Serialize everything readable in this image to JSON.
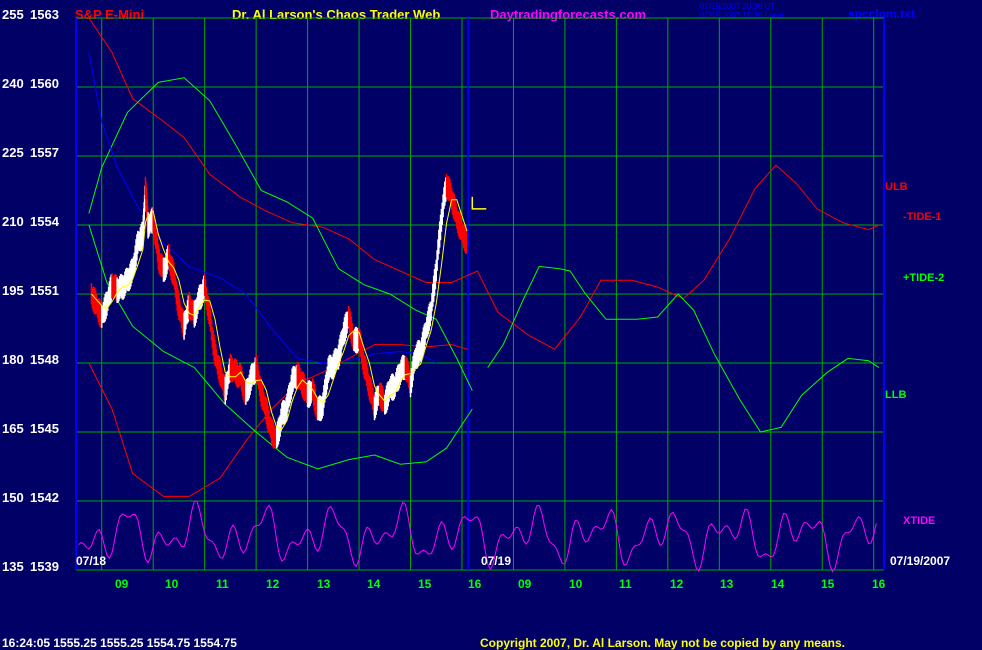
{
  "header": {
    "instrument": "S&P E-Mini",
    "title": "Dr. Al Larson's Chaos Trader Web",
    "site": "Daytradingforecasts.com",
    "timestamp1": "07/19/2007 20:30 UT",
    "timestamp2": "07/19/2007 15:30 Local",
    "file": "spcclom.txt"
  },
  "footer": {
    "quote": "16:24:05  1555.25  1555.25  1554.75  1554.75",
    "copyright": "Copyright 2007, Dr. Al Larson. May not be copied by any means."
  },
  "colors": {
    "background": "#000066",
    "grid": "#00aa00",
    "price_up": "#ffffff",
    "price_down": "#ff0000",
    "ma": "#ffff00",
    "ulb": "#ff0000",
    "tide1": "#ff0000",
    "tide2": "#00ff00",
    "llb": "#00ff00",
    "blue_avg": "#0000ff",
    "xtide": "#ff00ff",
    "instrument_label": "#ff0000",
    "title": "#ffff00",
    "site": "#ff00ff",
    "file": "#0000ff"
  },
  "chart_data": {
    "type": "line",
    "ylabels": [
      {
        "left": "255",
        "right": "1563"
      },
      {
        "left": "240",
        "right": "1560"
      },
      {
        "left": "225",
        "right": "1557"
      },
      {
        "left": "210",
        "right": "1554"
      },
      {
        "left": "195",
        "right": "1551"
      },
      {
        "left": "180",
        "right": "1548"
      },
      {
        "left": "165",
        "right": "1545"
      },
      {
        "left": "150",
        "right": "1542"
      },
      {
        "left": "135",
        "right": "1539"
      }
    ],
    "ylim": [
      1539,
      1563
    ],
    "xlim": [
      8.5,
      24.2
    ],
    "date_left": "07/18",
    "date_mid": "07/19",
    "date_right": "07/19/2007",
    "xticks": [
      {
        "label": "09",
        "x": 9
      },
      {
        "label": "10",
        "x": 10
      },
      {
        "label": "11",
        "x": 11
      },
      {
        "label": "12",
        "x": 12
      },
      {
        "label": "13",
        "x": 13
      },
      {
        "label": "14",
        "x": 14
      },
      {
        "label": "15",
        "x": 15
      },
      {
        "label": "16",
        "x": 16
      },
      {
        "label": "09",
        "x": 17
      },
      {
        "label": "10",
        "x": 18
      },
      {
        "label": "11",
        "x": 19
      },
      {
        "label": "12",
        "x": 20
      },
      {
        "label": "13",
        "x": 21
      },
      {
        "label": "14",
        "x": 22
      },
      {
        "label": "15",
        "x": 23
      },
      {
        "label": "16",
        "x": 24
      }
    ],
    "day_divider_x": 16.12,
    "series": [
      {
        "name": "ULB",
        "key": "ulb",
        "points": [
          [
            8.75,
            1563
          ],
          [
            9.2,
            1561.5
          ],
          [
            9.6,
            1559.5
          ],
          [
            10.2,
            1558.5
          ],
          [
            10.6,
            1557.8
          ],
          [
            11.1,
            1556.2
          ],
          [
            11.7,
            1555.2
          ],
          [
            12.2,
            1554.6
          ],
          [
            12.7,
            1554.1
          ],
          [
            13.3,
            1553.9
          ],
          [
            13.8,
            1553.4
          ],
          [
            14.3,
            1552.5
          ],
          [
            14.8,
            1552.0
          ],
          [
            15.3,
            1551.5
          ],
          [
            15.8,
            1551.5
          ],
          [
            16.3,
            1552.0
          ],
          [
            16.7,
            1550.2
          ],
          [
            17.3,
            1549.2
          ],
          [
            17.8,
            1548.6
          ],
          [
            18.3,
            1550.0
          ],
          [
            18.7,
            1551.6
          ],
          [
            19.3,
            1551.6
          ],
          [
            19.8,
            1551.3
          ],
          [
            20.3,
            1550.8
          ],
          [
            20.7,
            1551.6
          ],
          [
            21.2,
            1553.4
          ],
          [
            21.7,
            1555.6
          ],
          [
            22.1,
            1556.6
          ],
          [
            22.5,
            1555.8
          ],
          [
            22.9,
            1554.7
          ],
          [
            23.4,
            1554.1
          ],
          [
            23.9,
            1553.8
          ],
          [
            24.1,
            1554.0
          ]
        ]
      },
      {
        "name": "-TIDE-1",
        "key": "tide1",
        "points": [
          [
            8.75,
            1548
          ],
          [
            9.2,
            1546.0
          ],
          [
            9.6,
            1543.2
          ],
          [
            10.2,
            1542.2
          ],
          [
            10.7,
            1542.2
          ],
          [
            11.3,
            1543.0
          ],
          [
            11.8,
            1544.6
          ],
          [
            12.3,
            1546.0
          ],
          [
            12.8,
            1547.1
          ],
          [
            13.3,
            1547.6
          ],
          [
            13.8,
            1548.2
          ],
          [
            14.3,
            1548.8
          ],
          [
            14.8,
            1548.8
          ],
          [
            15.3,
            1548.7
          ],
          [
            15.8,
            1548.8
          ],
          [
            16.1,
            1548.6
          ]
        ]
      },
      {
        "name": "+TIDE-2",
        "key": "tide2",
        "points": [
          [
            16.5,
            1547.8
          ],
          [
            16.8,
            1548.8
          ],
          [
            17.2,
            1550.8
          ],
          [
            17.5,
            1552.2
          ],
          [
            17.9,
            1552.1
          ],
          [
            18.1,
            1552.0
          ],
          [
            18.4,
            1551.0
          ],
          [
            18.8,
            1549.9
          ],
          [
            19.4,
            1549.9
          ],
          [
            19.8,
            1550.0
          ],
          [
            20.2,
            1551.0
          ],
          [
            20.5,
            1550.3
          ],
          [
            20.9,
            1548.4
          ],
          [
            21.4,
            1546.4
          ],
          [
            21.8,
            1545.0
          ],
          [
            22.2,
            1545.2
          ],
          [
            22.6,
            1546.6
          ],
          [
            23.1,
            1547.6
          ],
          [
            23.5,
            1548.2
          ],
          [
            23.9,
            1548.1
          ],
          [
            24.1,
            1547.8
          ]
        ]
      },
      {
        "name": "LLB",
        "key": "llb",
        "points": [
          [
            8.75,
            1554.5
          ],
          [
            9.0,
            1556.5
          ],
          [
            9.5,
            1558.9
          ],
          [
            10.1,
            1560.2
          ],
          [
            10.6,
            1560.4
          ],
          [
            11.1,
            1559.4
          ],
          [
            11.6,
            1557.5
          ],
          [
            12.1,
            1555.5
          ],
          [
            12.6,
            1555.0
          ],
          [
            13.1,
            1554.3
          ],
          [
            13.6,
            1552.1
          ],
          [
            14.1,
            1551.4
          ],
          [
            14.6,
            1551.0
          ],
          [
            15.1,
            1550.3
          ],
          [
            15.5,
            1549.9
          ],
          [
            15.9,
            1548.2
          ],
          [
            16.2,
            1546.8
          ]
        ]
      },
      {
        "name": "",
        "key": "blue_avg",
        "points": [
          [
            8.75,
            1561.5
          ],
          [
            9.0,
            1558.5
          ],
          [
            9.3,
            1556.5
          ],
          [
            9.7,
            1554.8
          ],
          [
            10.2,
            1553.2
          ],
          [
            10.7,
            1552.2
          ],
          [
            11.3,
            1551.7
          ],
          [
            11.8,
            1551.0
          ],
          [
            12.3,
            1549.5
          ],
          [
            12.8,
            1548.2
          ],
          [
            13.3,
            1548.0
          ],
          [
            13.8,
            1548.1
          ],
          [
            14.3,
            1548.4
          ],
          [
            14.8,
            1548.5
          ],
          [
            15.2,
            1548.4
          ],
          [
            15.5,
            1548.0
          ]
        ]
      },
      {
        "name": "",
        "key": "llb_lower",
        "points": [
          [
            8.75,
            1554.0
          ],
          [
            9.1,
            1551.5
          ],
          [
            9.6,
            1549.6
          ],
          [
            10.2,
            1548.5
          ],
          [
            10.8,
            1547.8
          ],
          [
            11.4,
            1546.2
          ],
          [
            12.0,
            1545.0
          ],
          [
            12.6,
            1543.9
          ],
          [
            13.2,
            1543.4
          ],
          [
            13.8,
            1543.8
          ],
          [
            14.3,
            1544.0
          ],
          [
            14.8,
            1543.6
          ],
          [
            15.3,
            1543.7
          ],
          [
            15.7,
            1544.3
          ],
          [
            16.2,
            1546.0
          ]
        ]
      }
    ],
    "xtide": {
      "name": "XTIDE",
      "baseline": 1540.5,
      "amp": 1.2
    },
    "price": [
      [
        8.8,
        1551.0
      ],
      [
        8.9,
        1550.5
      ],
      [
        9.0,
        1550.0
      ],
      [
        9.1,
        1550.6
      ],
      [
        9.2,
        1551.4
      ],
      [
        9.3,
        1551.2
      ],
      [
        9.4,
        1551.3
      ],
      [
        9.5,
        1551.6
      ],
      [
        9.6,
        1552.0
      ],
      [
        9.7,
        1553.2
      ],
      [
        9.8,
        1553.6
      ],
      [
        9.85,
        1555.6
      ],
      [
        9.9,
        1554.0
      ],
      [
        10.0,
        1554.2
      ],
      [
        10.1,
        1552.6
      ],
      [
        10.2,
        1552.0
      ],
      [
        10.3,
        1552.6
      ],
      [
        10.4,
        1551.8
      ],
      [
        10.5,
        1550.4
      ],
      [
        10.6,
        1549.6
      ],
      [
        10.7,
        1550.5
      ],
      [
        10.8,
        1550.1
      ],
      [
        10.9,
        1550.8
      ],
      [
        11.0,
        1551.3
      ],
      [
        11.1,
        1550.0
      ],
      [
        11.2,
        1548.4
      ],
      [
        11.3,
        1547.6
      ],
      [
        11.4,
        1546.8
      ],
      [
        11.5,
        1547.8
      ],
      [
        11.6,
        1547.6
      ],
      [
        11.7,
        1547.4
      ],
      [
        11.8,
        1546.6
      ],
      [
        11.9,
        1547.3
      ],
      [
        12.0,
        1547.8
      ],
      [
        12.1,
        1546.7
      ],
      [
        12.2,
        1545.9
      ],
      [
        12.3,
        1545.0
      ],
      [
        12.4,
        1544.7
      ],
      [
        12.5,
        1545.7
      ],
      [
        12.6,
        1546.1
      ],
      [
        12.7,
        1547.2
      ],
      [
        12.8,
        1547.5
      ],
      [
        12.9,
        1547.1
      ],
      [
        13.0,
        1546.6
      ],
      [
        13.1,
        1546.8
      ],
      [
        13.2,
        1545.9
      ],
      [
        13.3,
        1546.2
      ],
      [
        13.4,
        1547.7
      ],
      [
        13.5,
        1547.9
      ],
      [
        13.6,
        1548.3
      ],
      [
        13.7,
        1549.3
      ],
      [
        13.8,
        1550.0
      ],
      [
        13.9,
        1548.9
      ],
      [
        14.0,
        1549.1
      ],
      [
        14.1,
        1547.9
      ],
      [
        14.2,
        1547.0
      ],
      [
        14.3,
        1546.1
      ],
      [
        14.4,
        1546.7
      ],
      [
        14.5,
        1546.2
      ],
      [
        14.6,
        1546.9
      ],
      [
        14.7,
        1547.0
      ],
      [
        14.8,
        1547.6
      ],
      [
        14.9,
        1547.9
      ],
      [
        15.0,
        1547.1
      ],
      [
        15.1,
        1548.3
      ],
      [
        15.2,
        1548.5
      ],
      [
        15.3,
        1549.4
      ],
      [
        15.4,
        1550.3
      ],
      [
        15.5,
        1552.1
      ],
      [
        15.6,
        1554.3
      ],
      [
        15.7,
        1555.8
      ],
      [
        15.8,
        1555.2
      ],
      [
        15.9,
        1554.3
      ],
      [
        16.0,
        1553.7
      ],
      [
        16.1,
        1553.2
      ]
    ]
  },
  "right_labels": {
    "ulb": "ULB",
    "tide1": "-TIDE-1",
    "tide2": "+TIDE-2",
    "llb": "LLB",
    "xtide": "XTIDE"
  }
}
